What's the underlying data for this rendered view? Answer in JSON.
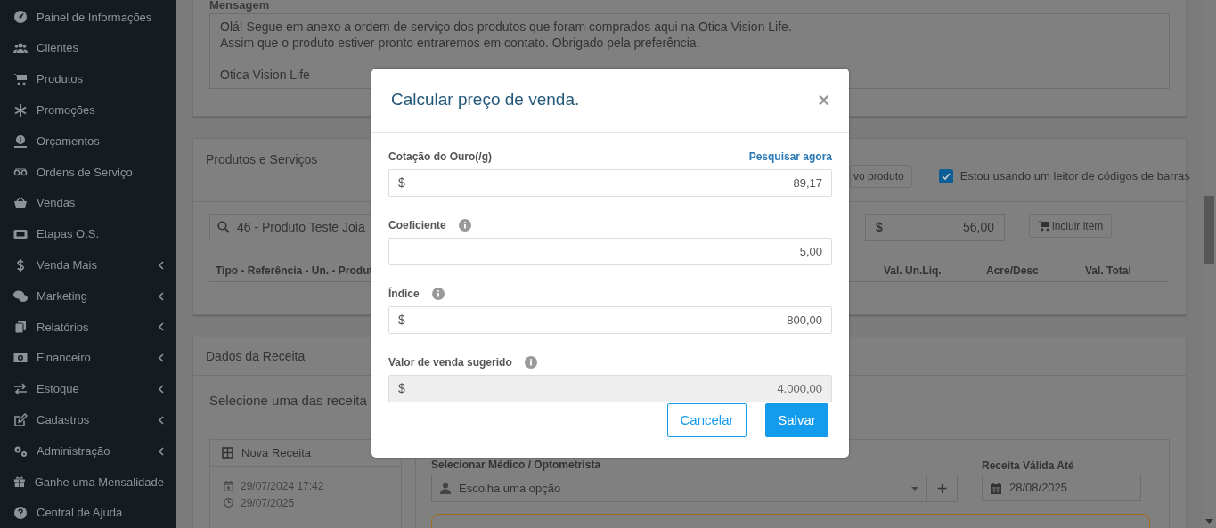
{
  "sidebar": {
    "items": [
      {
        "label": "Painel de Informações",
        "has_submenu": false
      },
      {
        "label": "Clientes",
        "has_submenu": false
      },
      {
        "label": "Produtos",
        "has_submenu": false
      },
      {
        "label": "Promoções",
        "has_submenu": false
      },
      {
        "label": "Orçamentos",
        "has_submenu": false
      },
      {
        "label": "Ordens de Serviço",
        "has_submenu": false
      },
      {
        "label": "Vendas",
        "has_submenu": false
      },
      {
        "label": "Etapas O.S.",
        "has_submenu": false
      },
      {
        "label": "Venda Mais",
        "has_submenu": true
      },
      {
        "label": "Marketing",
        "has_submenu": true
      },
      {
        "label": "Relatórios",
        "has_submenu": true
      },
      {
        "label": "Financeiro",
        "has_submenu": true
      },
      {
        "label": "Estoque",
        "has_submenu": true
      },
      {
        "label": "Cadastros",
        "has_submenu": true
      },
      {
        "label": "Administração",
        "has_submenu": true
      },
      {
        "label": "Ganhe uma Mensalidade",
        "has_submenu": false
      },
      {
        "label": "Central de Ajuda",
        "has_submenu": false
      }
    ]
  },
  "message_panel": {
    "label": "Mensagem",
    "text": "Olá! Segue em anexo a ordem de serviço dos produtos que foram comprados aqui na Otica Vision Life.\nAssim que o produto estiver pronto entraremos em contato. Obrigado pela preferência.\n\nOtica Vision Life"
  },
  "products_panel": {
    "title": "Produtos e Serviços",
    "new_product_button": "vo produto",
    "barcode_checkbox": {
      "label": "Estou usando um leitor de códigos de barras",
      "checked": true
    },
    "search": {
      "value": "46 - Produto Teste Joia"
    },
    "price": {
      "prefix": "$",
      "value": "56,00"
    },
    "add_item_button": "incluir item",
    "columns": [
      "Tipo - Referência - Un. - Produt",
      "Val. Un.Liq.",
      "Acre/Desc",
      "Val. Total"
    ]
  },
  "prescription_panel": {
    "title": "Dados da Receita",
    "heading": "Selecione uma das receita",
    "new_prescription": "Nova Receita",
    "created": "29/07/2024 17:42",
    "expires": "29/07/2025",
    "doctor_label": "Selecionar Médico / Optometrista",
    "doctor_select": {
      "value": "Escolha uma opção"
    },
    "add_doctor_button": "+",
    "valid_until_label": "Receita Válida Até",
    "valid_until": "28/08/2025"
  },
  "dialog": {
    "title": "Calcular preço de venda.",
    "close": "×",
    "fields": [
      {
        "label": "Cotação do Ouro(/g)",
        "prefix": "$",
        "value": "89,17",
        "info": false,
        "link": "Pesquisar agora",
        "disabled": false
      },
      {
        "label": "Coeficiente",
        "value": "5,00",
        "info": true,
        "disabled": false
      },
      {
        "label": "Índice",
        "prefix": "$",
        "value": "800,00",
        "info": true,
        "disabled": false
      },
      {
        "label": "Valor de venda sugerido",
        "prefix": "$",
        "value": "4.000,00",
        "info": true,
        "disabled": true
      }
    ],
    "buttons": [
      {
        "label": "Cancelar",
        "kind": "secondary"
      },
      {
        "label": "Salvar",
        "kind": "primary"
      }
    ]
  }
}
